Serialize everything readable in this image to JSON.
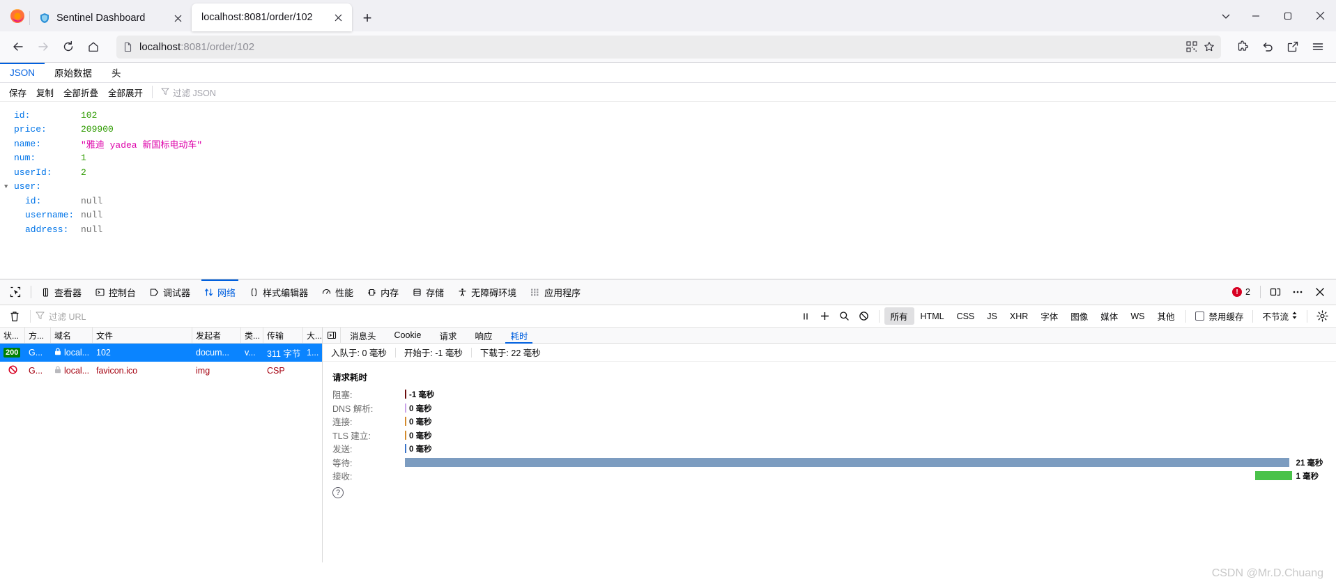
{
  "browser": {
    "tabs": [
      {
        "title": "Sentinel Dashboard",
        "favicon": "sentinel-icon",
        "active": false
      },
      {
        "title": "localhost:8081/order/102",
        "favicon": "none",
        "active": true
      }
    ],
    "new_tab_label": "+",
    "tab_list_chevron": "chevron-down-icon",
    "window_controls": [
      "minimize",
      "maximize",
      "close"
    ],
    "nav": {
      "back": "back-icon",
      "forward": "forward-icon",
      "reload": "reload-icon",
      "home": "home-icon",
      "url_host": "localhost",
      "url_path": ":8081/order/102",
      "url_full": "localhost:8081/order/102",
      "page_icon": "document-icon",
      "qr_icon": "qr-icon",
      "bookmark_icon": "star-icon",
      "extensions_icon": "extensions-icon",
      "undo_icon": "undo-icon",
      "share_icon": "share-icon",
      "menu_icon": "hamburger-menu-icon"
    }
  },
  "json_viewer": {
    "tabs": [
      {
        "label": "JSON",
        "active": true
      },
      {
        "label": "原始数据",
        "active": false
      },
      {
        "label": "头",
        "active": false
      }
    ],
    "toolbar": {
      "save": "保存",
      "copy": "复制",
      "collapse_all": "全部折叠",
      "expand_all": "全部展开",
      "filter_placeholder": "过滤 JSON",
      "filter_icon": "filter-icon"
    },
    "rows": [
      {
        "key": "id:",
        "value": "102",
        "type": "num",
        "level": 1,
        "twisty": ""
      },
      {
        "key": "price:",
        "value": "209900",
        "type": "num",
        "level": 1,
        "twisty": ""
      },
      {
        "key": "name:",
        "value": "\"雅迪 yadea 新国标电动车\"",
        "type": "str",
        "level": 1,
        "twisty": ""
      },
      {
        "key": "num:",
        "value": "1",
        "type": "num",
        "level": 1,
        "twisty": ""
      },
      {
        "key": "userId:",
        "value": "2",
        "type": "num",
        "level": 1,
        "twisty": ""
      },
      {
        "key": "user:",
        "value": "",
        "type": "obj",
        "level": 0,
        "twisty": "▼"
      },
      {
        "key": "id:",
        "value": "null",
        "type": "null",
        "level": 2,
        "twisty": ""
      },
      {
        "key": "username:",
        "value": "null",
        "type": "null",
        "level": 2,
        "twisty": ""
      },
      {
        "key": "address:",
        "value": "null",
        "type": "null",
        "level": 2,
        "twisty": ""
      }
    ]
  },
  "devtools": {
    "picker_icon": "element-picker-icon",
    "tabs": [
      {
        "label": "查看器",
        "icon": "inspector-icon",
        "active": false
      },
      {
        "label": "控制台",
        "icon": "console-icon",
        "active": false
      },
      {
        "label": "调试器",
        "icon": "debugger-icon",
        "active": false
      },
      {
        "label": "网络",
        "icon": "network-icon",
        "active": true
      },
      {
        "label": "样式编辑器",
        "icon": "style-editor-icon",
        "active": false
      },
      {
        "label": "性能",
        "icon": "performance-icon",
        "active": false
      },
      {
        "label": "内存",
        "icon": "memory-icon",
        "active": false
      },
      {
        "label": "存储",
        "icon": "storage-icon",
        "active": false
      },
      {
        "label": "无障碍环境",
        "icon": "accessibility-icon",
        "active": false
      },
      {
        "label": "应用程序",
        "icon": "application-icon",
        "active": false
      }
    ],
    "error_count": "2",
    "error_icon": "error-badge-icon",
    "dock_icon": "dock-icon",
    "more_icon": "more-options-icon",
    "close_icon": "close-devtools-icon",
    "network_toolbar": {
      "clear_icon": "trash-icon",
      "filter_icon": "filter-icon",
      "filter_placeholder": "过滤 URL",
      "pause_icon": "pause-icon",
      "add_icon": "plus-icon",
      "search_icon": "search-icon",
      "block_icon": "block-icon",
      "type_filters": [
        {
          "label": "所有",
          "active": true
        },
        {
          "label": "HTML",
          "active": false
        },
        {
          "label": "CSS",
          "active": false
        },
        {
          "label": "JS",
          "active": false
        },
        {
          "label": "XHR",
          "active": false
        },
        {
          "label": "字体",
          "active": false
        },
        {
          "label": "图像",
          "active": false
        },
        {
          "label": "媒体",
          "active": false
        },
        {
          "label": "WS",
          "active": false
        },
        {
          "label": "其他",
          "active": false
        }
      ],
      "disable_cache_label": "禁用缓存",
      "disable_cache_checked": false,
      "throttle_label": "不节流",
      "settings_icon": "gear-icon"
    },
    "request_table": {
      "columns": [
        "状...",
        "方...",
        "域名",
        "文件",
        "发起者",
        "类...",
        "传输",
        "大..."
      ],
      "rows": [
        {
          "status": "200",
          "method": "G...",
          "domain": "local...",
          "file": "102",
          "initiator": "docum...",
          "type": "v...",
          "transfer": "311 字节",
          "size": "1...",
          "selected": true,
          "blocked": false,
          "lock_icon": "lock-icon"
        },
        {
          "status": "",
          "method": "G...",
          "domain": "local...",
          "file": "favicon.ico",
          "initiator": "img",
          "type": "",
          "transfer": "CSP",
          "size": "",
          "selected": false,
          "blocked": true,
          "status_icon": "blocked-icon",
          "lock_icon": "lock-icon"
        }
      ]
    },
    "detail": {
      "toggle_icon": "panel-toggle-icon",
      "tabs": [
        {
          "label": "消息头",
          "active": false
        },
        {
          "label": "Cookie",
          "active": false
        },
        {
          "label": "请求",
          "active": false
        },
        {
          "label": "响应",
          "active": false
        },
        {
          "label": "耗时",
          "active": true
        }
      ],
      "summary": [
        "入队于: 0 毫秒",
        "开始于: -1 毫秒",
        "下载于: 22 毫秒"
      ],
      "timings_title": "请求耗时",
      "timings": [
        {
          "label": "阻塞:",
          "value": "-1 毫秒",
          "bar_pct": 0,
          "color": "#6b0b0b"
        },
        {
          "label": "DNS 解析:",
          "value": "0 毫秒",
          "bar_pct": 0,
          "color": "#c9a3e8"
        },
        {
          "label": "连接:",
          "value": "0 毫秒",
          "bar_pct": 0,
          "color": "#d48b2c"
        },
        {
          "label": "TLS 建立:",
          "value": "0 毫秒",
          "bar_pct": 0,
          "color": "#d48b2c"
        },
        {
          "label": "发送:",
          "value": "0 毫秒",
          "bar_pct": 0,
          "color": "#3a73c8"
        },
        {
          "label": "等待:",
          "value": "21 毫秒",
          "bar_pct": 95,
          "color": "#7c9cc0"
        },
        {
          "label": "接收:",
          "value": "1 毫秒",
          "bar_pct": 4,
          "color": "#4ac24a"
        }
      ],
      "help_icon": "help-icon"
    }
  },
  "watermark": "CSDN @Mr.D.Chuang",
  "colors": {
    "accent": "#0060df",
    "selection": "#0a84ff",
    "error": "#d70022",
    "success": "#008000"
  }
}
